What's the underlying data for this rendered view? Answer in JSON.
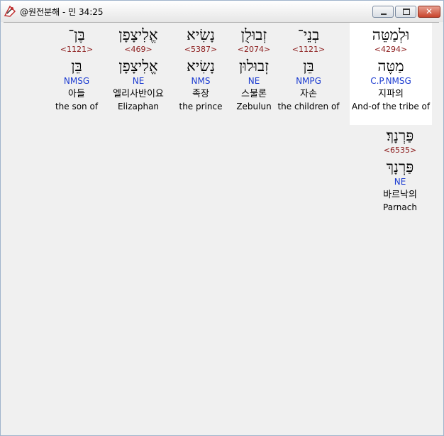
{
  "window": {
    "title": "@원전분해 - 민 34:25",
    "close_glyph": "✕"
  },
  "words": [
    {
      "hebrew": "וּלְמַטֵּה",
      "strong": "<4294>",
      "lemma": "מַטֶּה",
      "parse": "C.P.NMSG",
      "korean": "지파의",
      "english": "And-of the tribe of",
      "highlight": true
    },
    {
      "hebrew": "בְנֵי־",
      "strong": "<1121>",
      "lemma": "בֵּן",
      "parse": "NMPG",
      "korean": "자손",
      "english": "the children of"
    },
    {
      "hebrew": "זְבוּלֻן",
      "strong": "<2074>",
      "lemma": "זְבוּלוּן",
      "parse": "NE",
      "korean": "스불론",
      "english": "Zebulun"
    },
    {
      "hebrew": "נָשִׂיא",
      "strong": "<5387>",
      "lemma": "נָשִׂיא",
      "parse": "NMS",
      "korean": "족장",
      "english": "the prince"
    },
    {
      "hebrew": "אֱלִיצָפָן",
      "strong": "<469>",
      "lemma": "אֱלִיצָפָן",
      "parse": "NE",
      "korean": "엘리사반이요",
      "english": "Elizaphan"
    },
    {
      "hebrew": "בֶּן־",
      "strong": "<1121>",
      "lemma": "בֵּן",
      "parse": "NMSG",
      "korean": "아들",
      "english": "the son of"
    },
    {
      "hebrew": "פַּרְנָךְ׃",
      "strong": "<6535>",
      "lemma": "פַּרְנָךְ",
      "parse": "NE",
      "korean": "바르낙의",
      "english": "Parnach"
    }
  ]
}
